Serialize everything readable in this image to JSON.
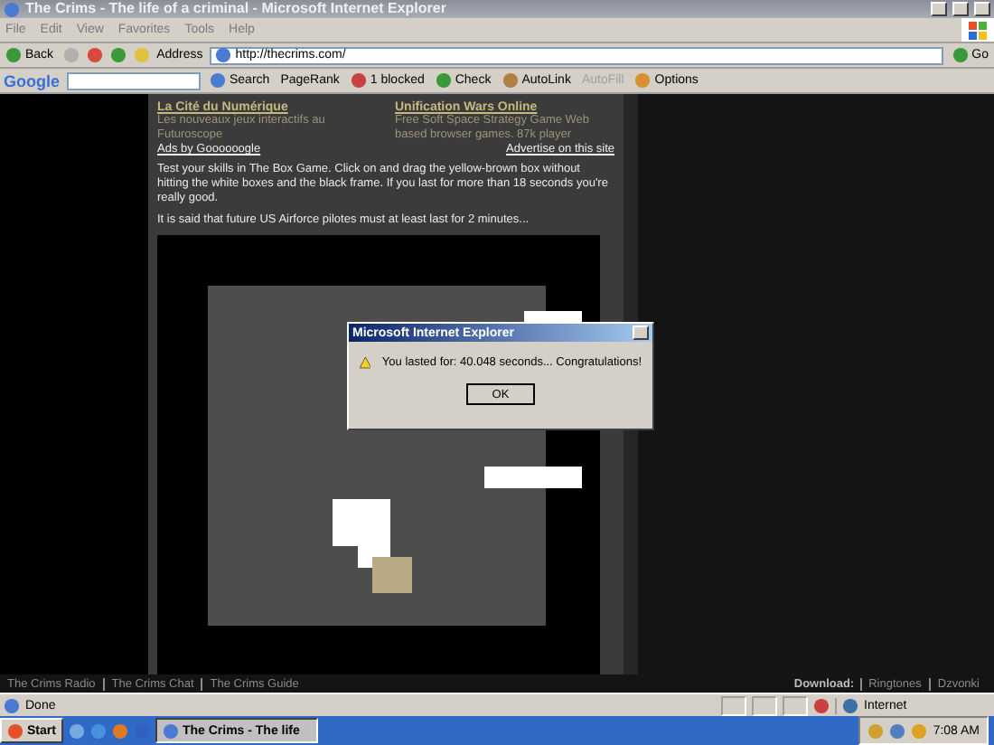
{
  "window": {
    "title": "The Crims - The life of a criminal - Microsoft Internet Explorer"
  },
  "menu": [
    "File",
    "Edit",
    "View",
    "Favorites",
    "Tools",
    "Help"
  ],
  "toolbar": {
    "back": "Back",
    "address_label": "Address",
    "address": "http://thecrims.com/",
    "go": "Go"
  },
  "google_bar": {
    "logo": "Google",
    "search": "Search",
    "pagerank": "PageRank",
    "blocked": "1 blocked",
    "check": "Check",
    "autolink": "AutoLink",
    "autofill": {
      "label": "AutoFill",
      "disabled": true
    },
    "options": "Options"
  },
  "ads": [
    {
      "title": "La Cité du Numérique",
      "text": "Les nouveaux jeux interactifs au Futuroscope"
    },
    {
      "title": "Unification Wars Online",
      "text": "Free Soft Space Strategy Game Web based browser games. 87k player"
    }
  ],
  "ads_by": "Ads by Goooooogle",
  "advertise": "Advertise on this site",
  "intro": "Test your skills in The Box Game. Click on and drag the yellow-brown box without hitting the white boxes and the black frame. If you last for more than 18 seconds you're really good.",
  "note": "It is said that future US Airforce pilotes must at least last for 2 minutes...",
  "dialog": {
    "title": "Microsoft Internet Explorer",
    "message": "You lasted for: 40.048 seconds... Congratulations!",
    "button": "OK"
  },
  "footer_links": [
    "The Crims Radio",
    "The Crims Chat",
    "The Crims Guide"
  ],
  "download": {
    "label": "Download:",
    "links": [
      "Ringtones",
      "Dzvonki"
    ]
  },
  "status": {
    "text": "Done",
    "zone": "Internet"
  },
  "taskbar": {
    "start": "Start",
    "task": "The Crims - The life",
    "clock": "7:08 AM"
  }
}
